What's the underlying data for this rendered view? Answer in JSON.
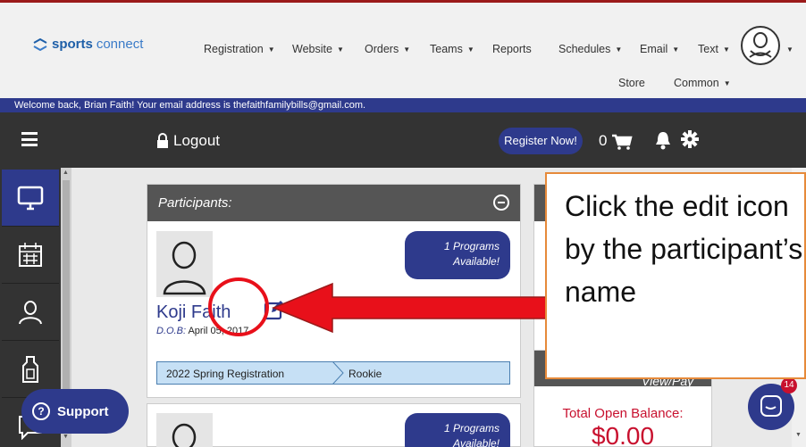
{
  "brand": {
    "bold": "sports",
    "light": "connect"
  },
  "nav": {
    "items": [
      {
        "label": "Registration",
        "has_caret": true
      },
      {
        "label": "Website",
        "has_caret": true
      },
      {
        "label": "Orders",
        "has_caret": true
      },
      {
        "label": "Teams",
        "has_caret": true
      },
      {
        "label": "Reports",
        "has_caret": false
      },
      {
        "label": "Schedules",
        "has_caret": true
      },
      {
        "label": "Email",
        "has_caret": true
      },
      {
        "label": "Text",
        "has_caret": true
      },
      {
        "label": "Store",
        "has_caret": false
      },
      {
        "label": "Common",
        "has_caret": true
      }
    ]
  },
  "welcome": "Welcome back, Brian Faith! Your email address is thefaithfamilybills@gmail.com.",
  "toolbar": {
    "logout": "Logout",
    "register": "Register Now!",
    "cart_count": "0"
  },
  "participants": {
    "header": "Participants:",
    "programs_line1": "1 Programs",
    "programs_line2": "Available!",
    "name": "Koji Faith",
    "dob_label": "D.O.B:",
    "dob_value": "April 05, 2017",
    "season": "2022 Spring Registration",
    "level": "Rookie"
  },
  "participant2": {
    "programs_line1": "1 Programs",
    "programs_line2": "Available!"
  },
  "account": {
    "view_pay": "View/Pay",
    "balance_label": "Total Open Balance:",
    "balance_amount": "$0.00"
  },
  "support": {
    "label": "Support"
  },
  "chat": {
    "badge": "14"
  },
  "annotation": {
    "text": "Click the edit icon by the participant’s name"
  },
  "colors": {
    "brand_blue": "#2e3a8c",
    "dark_bar": "#333333",
    "balance_red": "#c8102e",
    "callout_border": "#e68a3a",
    "arrow_red": "#e8101a"
  }
}
